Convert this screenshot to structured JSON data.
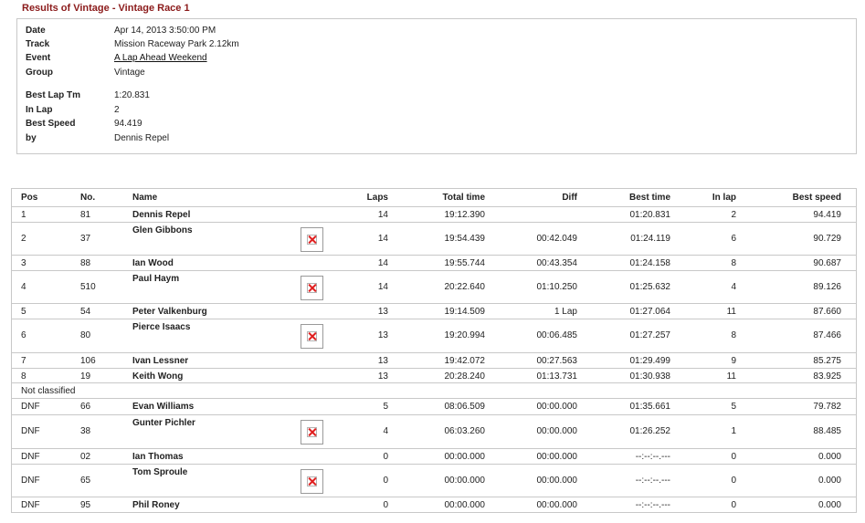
{
  "page": {
    "title": "Results of Vintage - Vintage Race 1"
  },
  "info": {
    "date_label": "Date",
    "date": "Apr 14, 2013 3:50:00 PM",
    "track_label": "Track",
    "track": "Mission Raceway Park 2.12km",
    "event_label": "Event",
    "event": "A Lap Ahead Weekend",
    "group_label": "Group",
    "group": "Vintage",
    "best_lap_label": "Best Lap Tm",
    "best_lap": "1:20.831",
    "in_lap_label": "In Lap",
    "in_lap": "2",
    "best_speed_label": "Best Speed",
    "best_speed": "94.419",
    "by_label": "by",
    "by": "Dennis Repel"
  },
  "results": {
    "headers": {
      "pos": "Pos",
      "no": "No.",
      "name": "Name",
      "laps": "Laps",
      "total": "Total time",
      "diff": "Diff",
      "best": "Best time",
      "inlap": "In lap",
      "speed": "Best speed"
    },
    "not_classified_label": "Not classified",
    "rows": [
      {
        "pos": "1",
        "no": "81",
        "name": "Dennis Repel",
        "laps": "14",
        "total": "19:12.390",
        "diff": "",
        "best": "01:20.831",
        "inlap": "2",
        "speed": "94.419"
      },
      {
        "pos": "2",
        "no": "37",
        "name": "Glen Gibbons",
        "laps": "14",
        "total": "19:54.439",
        "diff": "00:42.049",
        "best": "01:24.119",
        "inlap": "6",
        "speed": "90.729"
      },
      {
        "pos": "3",
        "no": "88",
        "name": "Ian Wood",
        "laps": "14",
        "total": "19:55.744",
        "diff": "00:43.354",
        "best": "01:24.158",
        "inlap": "8",
        "speed": "90.687"
      },
      {
        "pos": "4",
        "no": "510",
        "name": "Paul Haym",
        "laps": "14",
        "total": "20:22.640",
        "diff": "01:10.250",
        "best": "01:25.632",
        "inlap": "4",
        "speed": "89.126"
      },
      {
        "pos": "5",
        "no": "54",
        "name": "Peter Valkenburg",
        "laps": "13",
        "total": "19:14.509",
        "diff": "1 Lap",
        "best": "01:27.064",
        "inlap": "11",
        "speed": "87.660"
      },
      {
        "pos": "6",
        "no": "80",
        "name": "Pierce Isaacs",
        "laps": "13",
        "total": "19:20.994",
        "diff": "00:06.485",
        "best": "01:27.257",
        "inlap": "8",
        "speed": "87.466"
      },
      {
        "pos": "7",
        "no": "106",
        "name": "Ivan Lessner",
        "laps": "13",
        "total": "19:42.072",
        "diff": "00:27.563",
        "best": "01:29.499",
        "inlap": "9",
        "speed": "85.275"
      },
      {
        "pos": "8",
        "no": "19",
        "name": "Keith Wong",
        "laps": "13",
        "total": "20:28.240",
        "diff": "01:13.731",
        "best": "01:30.938",
        "inlap": "11",
        "speed": "83.925"
      },
      {
        "pos": "DNF",
        "no": "66",
        "name": "Evan Williams",
        "laps": "5",
        "total": "08:06.509",
        "diff": "00:00.000",
        "best": "01:35.661",
        "inlap": "5",
        "speed": "79.782"
      },
      {
        "pos": "DNF",
        "no": "38",
        "name": "Gunter Pichler",
        "laps": "4",
        "total": "06:03.260",
        "diff": "00:00.000",
        "best": "01:26.252",
        "inlap": "1",
        "speed": "88.485"
      },
      {
        "pos": "DNF",
        "no": "02",
        "name": "Ian Thomas",
        "laps": "0",
        "total": "00:00.000",
        "diff": "00:00.000",
        "best": "--:--:--.---",
        "inlap": "0",
        "speed": "0.000"
      },
      {
        "pos": "DNF",
        "no": "65",
        "name": "Tom Sproule",
        "laps": "0",
        "total": "00:00.000",
        "diff": "00:00.000",
        "best": "--:--:--.---",
        "inlap": "0",
        "speed": "0.000"
      },
      {
        "pos": "DNF",
        "no": "95",
        "name": "Phil Roney",
        "laps": "0",
        "total": "00:00.000",
        "diff": "00:00.000",
        "best": "--:--:--.---",
        "inlap": "0",
        "speed": "0.000"
      }
    ]
  }
}
